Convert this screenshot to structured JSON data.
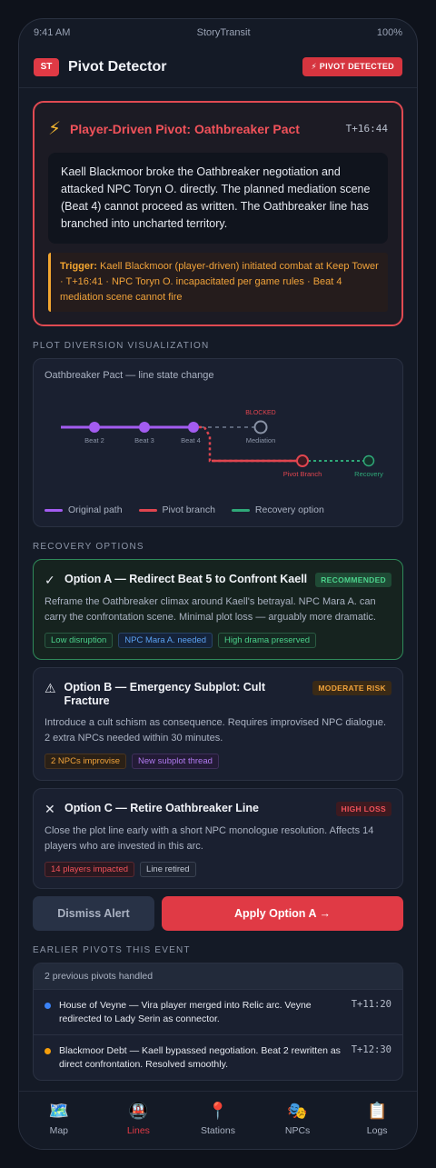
{
  "status_bar": {
    "time": "9:41 AM",
    "carrier": "StoryTransit",
    "battery": "100%"
  },
  "header": {
    "logo": "ST",
    "title": "Pivot Detector",
    "badge": "⚡ PIVOT DETECTED"
  },
  "alert": {
    "icon": "lightning-icon",
    "title": "Player-Driven Pivot: Oathbreaker Pact",
    "time": "T+16:44",
    "body": "Kaell Blackmoor broke the Oathbreaker negotiation and attacked NPC Toryn O. directly. The planned mediation scene (Beat 4) cannot proceed as written. The Oathbreaker line has branched into uncharted territory.",
    "trigger_label": "Trigger:",
    "trigger_text": "Kaell Blackmoor (player-driven) initiated combat at Keep Tower · T+16:41 · NPC Toryn O. incapacitated per game rules · Beat 4 mediation scene cannot fire"
  },
  "visualization": {
    "section_label": "PLOT DIVERSION VISUALIZATION",
    "title": "Oathbreaker Pact — line state change",
    "nodes": {
      "beat2": "Beat 2",
      "beat3": "Beat 3",
      "beat4": "Beat 4",
      "mediation": "Mediation",
      "blocked": "BLOCKED",
      "pivot_branch": "Pivot Branch",
      "recovery": "Recovery"
    },
    "legend": {
      "original": "Original path",
      "pivot": "Pivot branch",
      "recovery": "Recovery option"
    },
    "colors": {
      "original": "#a35cf0",
      "pivot": "#e0454f",
      "recovery": "#2fa878",
      "blocked": "#8a93a6"
    }
  },
  "recovery": {
    "section_label": "RECOVERY OPTIONS",
    "options": [
      {
        "icon": "check-icon",
        "title": "Option A — Redirect Beat 5 to Confront Kaell",
        "tag": "RECOMMENDED",
        "desc": "Reframe the Oathbreaker climax around Kaell's betrayal. NPC Mara A. can carry the confrontation scene. Minimal plot loss — arguably more dramatic.",
        "chips": [
          "Low disruption",
          "NPC Mara A. needed",
          "High drama preserved"
        ]
      },
      {
        "icon": "warning-icon",
        "title": "Option B — Emergency Subplot: Cult Fracture",
        "tag": "MODERATE RISK",
        "desc": "Introduce a cult schism as consequence. Requires improvised NPC dialogue. 2 extra NPCs needed within 30 minutes.",
        "chips": [
          "2 NPCs improvise",
          "New subplot thread"
        ]
      },
      {
        "icon": "close-icon",
        "title": "Option C — Retire Oathbreaker Line",
        "tag": "HIGH LOSS",
        "desc": "Close the plot line early with a short NPC monologue resolution. Affects 14 players who are invested in this arc.",
        "chips": [
          "14 players impacted",
          "Line retired"
        ]
      }
    ]
  },
  "actions": {
    "dismiss": "Dismiss Alert",
    "apply": "Apply Option A →"
  },
  "earlier": {
    "section_label": "EARLIER PIVOTS THIS EVENT",
    "head": "2 previous pivots handled",
    "items": [
      {
        "text": "House of Veyne — Vira player merged into Relic arc. Veyne redirected to Lady Serin as connector.",
        "time": "T+11:20",
        "color": "#3b82f6"
      },
      {
        "text": "Blackmoor Debt — Kaell bypassed negotiation. Beat 2 rewritten as direct confrontation. Resolved smoothly.",
        "time": "T+12:30",
        "color": "#f59e0b"
      }
    ]
  },
  "tabbar": {
    "tabs": [
      {
        "label": "Map",
        "icon": "map-icon",
        "glyph": "🗺️"
      },
      {
        "label": "Lines",
        "icon": "train-icon",
        "glyph": "🚇"
      },
      {
        "label": "Stations",
        "icon": "pin-icon",
        "glyph": "📍"
      },
      {
        "label": "NPCs",
        "icon": "masks-icon",
        "glyph": "🎭"
      },
      {
        "label": "Logs",
        "icon": "clipboard-icon",
        "glyph": "📋"
      }
    ],
    "active": "Lines"
  }
}
